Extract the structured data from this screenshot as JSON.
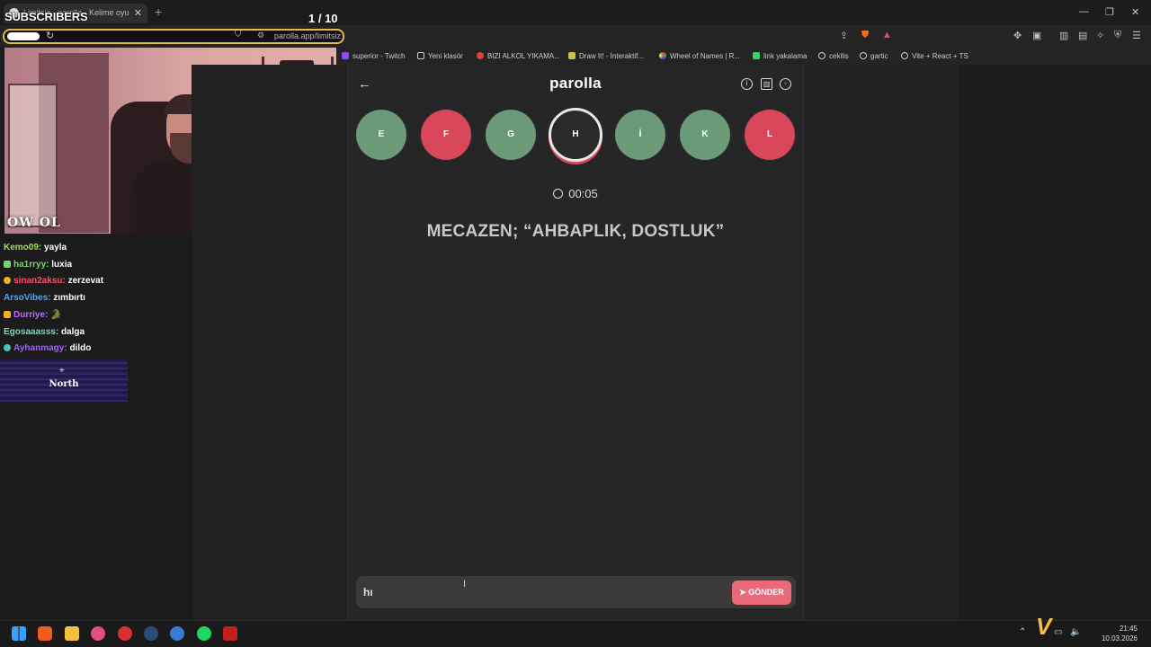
{
  "browser": {
    "tab_title": "Limitsiz - parolla - Kelime oyu",
    "url": "parolla.app/limitsiz",
    "bookmarks": [
      "superior - Twitch",
      "Yeni klasör",
      "BIZI ALKOL YIKAMA...",
      "Draw It! - İnteraktif...",
      "Wheel of Names | R...",
      "link yakalama",
      "cekilis",
      "gartic",
      "Vite + React + TS"
    ]
  },
  "overlay": {
    "subscribers_label": "SUBSCRIBERS",
    "counter": "1  / 10",
    "logo_text": "OW OL",
    "north_label": "North"
  },
  "chat": [
    {
      "user": "Kemo09",
      "text": "yayla",
      "color": "#9be05a"
    },
    {
      "user": "ha1rryy",
      "text": "luxia",
      "color": "#7ad46e"
    },
    {
      "user": "sinan2aksu",
      "text": "zerzevat",
      "color": "#ff4f6a"
    },
    {
      "user": "ArsoVibes",
      "text": "zımbırtı",
      "color": "#4aa8ff"
    },
    {
      "user": "Durriye",
      "text": "🐊",
      "color": "#c06bff"
    },
    {
      "user": "Egosaaasss",
      "text": "dalga",
      "color": "#6be0c0"
    },
    {
      "user": "Ayhanmagy",
      "text": "dildo",
      "color": "#a45cff"
    }
  ],
  "game": {
    "title": "parolla",
    "letters": [
      {
        "char": "E",
        "state": "green"
      },
      {
        "char": "F",
        "state": "red"
      },
      {
        "char": "G",
        "state": "green"
      },
      {
        "char": "H",
        "state": "active"
      },
      {
        "char": "İ",
        "state": "green"
      },
      {
        "char": "K",
        "state": "green"
      },
      {
        "char": "L",
        "state": "red"
      }
    ],
    "timer": "00:05",
    "clue": "MECAZEN; “AHBAPLIK, DOSTLUK”",
    "answer_value": "hı",
    "send_label": "GÖNDER"
  },
  "taskbar": {
    "time": "21:45",
    "date": "10.03.2026"
  },
  "colors": {
    "green": "#6a9a78",
    "red": "#d8485a",
    "send": "#e86a78",
    "address_border": "#e8b84a"
  }
}
